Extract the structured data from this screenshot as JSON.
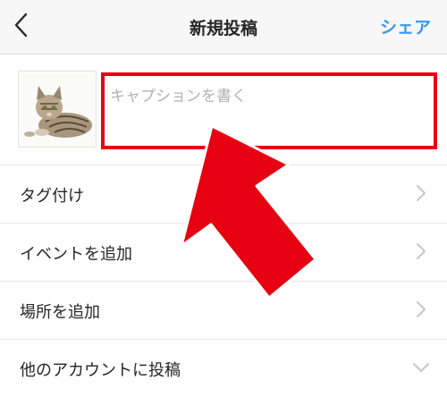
{
  "header": {
    "back_icon": "chevron-left-icon",
    "title": "新規投稿",
    "share_label": "シェア"
  },
  "composer": {
    "thumbnail_alt": "cat-photo",
    "caption_value": "",
    "caption_placeholder": "キャプションを書く",
    "highlight_color": "#e60012"
  },
  "options": [
    {
      "label": "タグ付け",
      "icon": "chevron-right-icon"
    },
    {
      "label": "イベントを追加",
      "icon": "chevron-right-icon"
    },
    {
      "label": "場所を追加",
      "icon": "chevron-right-icon"
    },
    {
      "label": "他のアカウントに投稿",
      "icon": "chevron-down-icon"
    }
  ],
  "colors": {
    "accent": "#3897f0",
    "annotation_red": "#e60012"
  }
}
